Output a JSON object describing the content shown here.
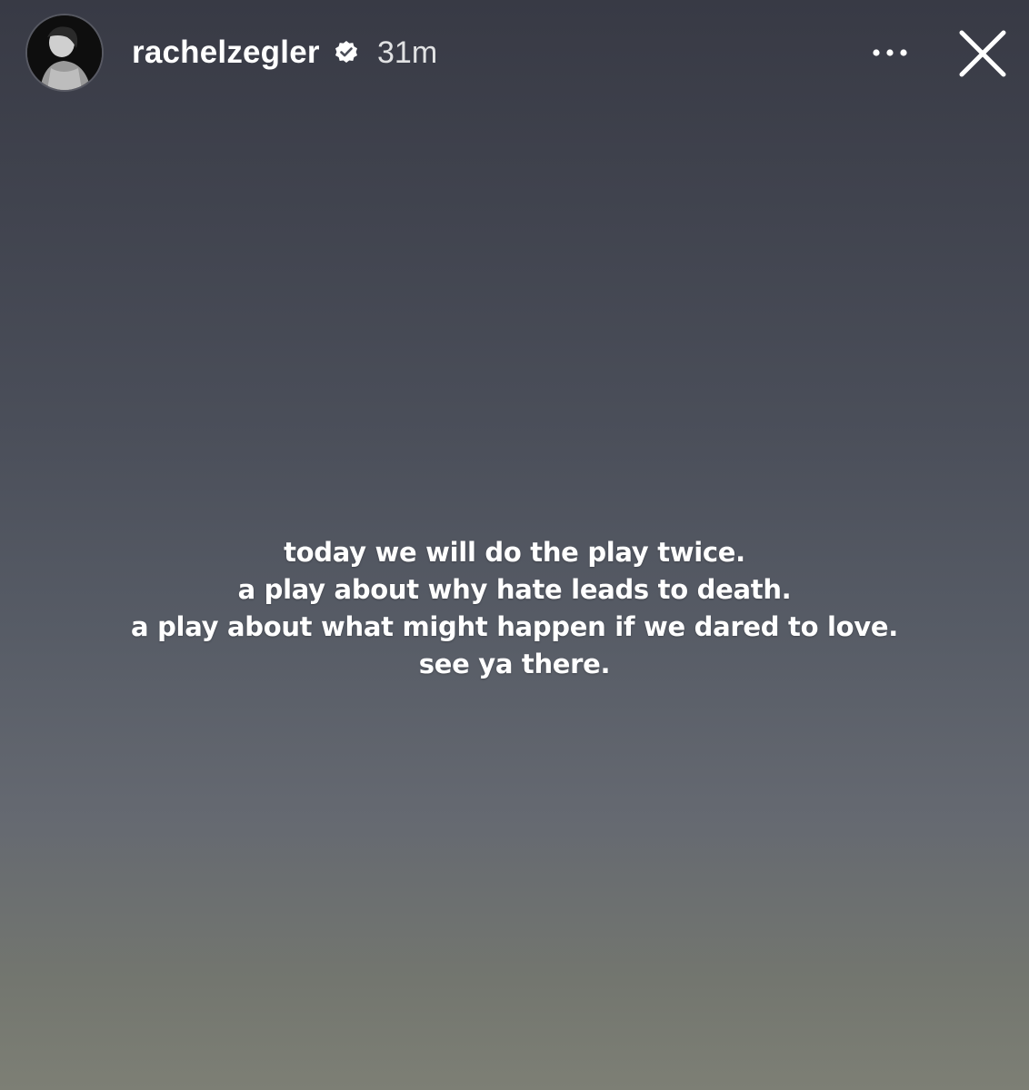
{
  "header": {
    "username": "rachelzegler",
    "verified_icon": "verified-badge-icon",
    "timestamp": "31m",
    "more_icon": "more-options-icon",
    "close_icon": "close-icon"
  },
  "story": {
    "caption_lines": [
      "today we will do the play twice.",
      "a play about why hate leads to death.",
      "a play about what might happen if we dared to love.",
      "see ya there."
    ]
  },
  "colors": {
    "text": "#ffffff",
    "background_top": "#383a45",
    "background_bottom": "#7d7f75"
  }
}
